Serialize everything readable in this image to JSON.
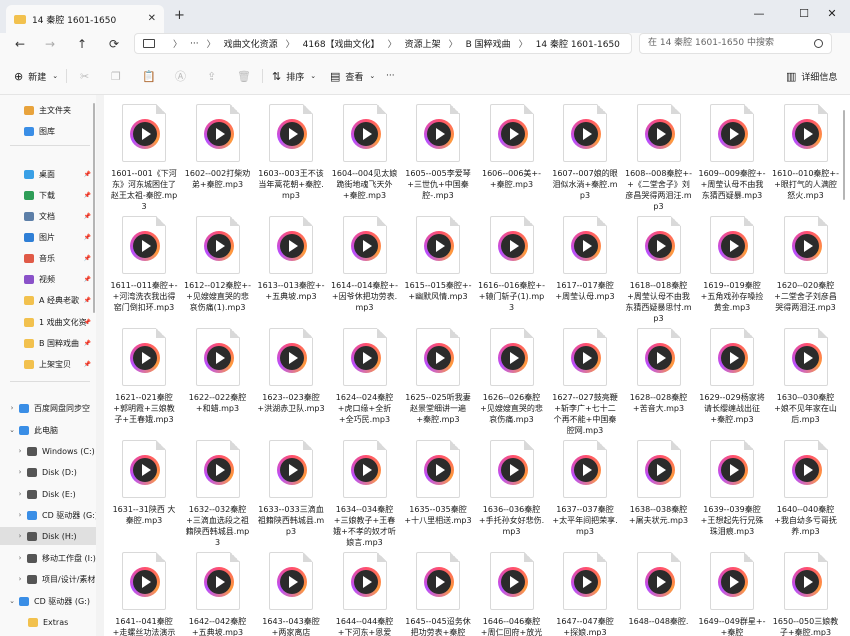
{
  "window": {
    "tab_title": "14 秦腔 1601-1650",
    "new_tab": "+",
    "close_tab": "✕",
    "minimize": "—",
    "maximize": "☐",
    "close": "✕"
  },
  "nav": {
    "back": "←",
    "forward": "→",
    "up": "↑",
    "refresh": "⟳",
    "more": "···",
    "breadcrumbs": [
      "戏曲文化资源",
      "4168【戏曲文化】",
      "资源上架",
      "B 国粹戏曲",
      "14 秦腔 1601-1650"
    ],
    "chevron": "〉",
    "search_placeholder": "在 14 秦腔 1601-1650 中搜索"
  },
  "toolbar": {
    "new_label": "新建",
    "sort_label": "排序",
    "view_label": "查看",
    "more": "···",
    "details_label": "详细信息"
  },
  "sidebar": {
    "items": [
      {
        "label": "主文件夹",
        "icon": "home-icon",
        "color": "#e8a33c"
      },
      {
        "label": "图库",
        "icon": "gallery-icon",
        "color": "#3a8ee6"
      },
      {
        "label": "桌面",
        "icon": "desktop-icon",
        "color": "#3aa0e6"
      },
      {
        "label": "下载",
        "icon": "download-icon",
        "color": "#2e9d57"
      },
      {
        "label": "文档",
        "icon": "document-icon",
        "color": "#5d7fa8"
      },
      {
        "label": "图片",
        "icon": "pictures-icon",
        "color": "#2f7fd6"
      },
      {
        "label": "音乐",
        "icon": "music-icon",
        "color": "#e05a47"
      },
      {
        "label": "视频",
        "icon": "video-icon",
        "color": "#8a52c9"
      },
      {
        "label": "A 经典老歌",
        "icon": "folder-icon",
        "color": "#f2c14e"
      },
      {
        "label": "1 戏曲文化资",
        "icon": "folder-icon",
        "color": "#f2c14e"
      },
      {
        "label": "B 国粹戏曲",
        "icon": "folder-icon",
        "color": "#f2c14e"
      },
      {
        "label": "上架宝贝",
        "icon": "folder-icon",
        "color": "#f2c14e"
      },
      {
        "label": "百度网盘同步空",
        "icon": "cloud-icon",
        "color": "#3a8ee6"
      },
      {
        "label": "此电脑",
        "icon": "computer-icon",
        "color": "#3a8ee6"
      },
      {
        "label": "Windows (C:)",
        "icon": "drive-icon",
        "color": "#555555"
      },
      {
        "label": "Disk (D:)",
        "icon": "drive-icon",
        "color": "#555555"
      },
      {
        "label": "Disk (E:)",
        "icon": "drive-icon",
        "color": "#555555"
      },
      {
        "label": "CD 驱动器 (G:)",
        "icon": "cd-icon",
        "color": "#3a8ee6"
      },
      {
        "label": "Disk (H:)",
        "icon": "drive-icon",
        "color": "#555555"
      },
      {
        "label": "移动工作盘 (I:)",
        "icon": "drive-icon",
        "color": "#555555"
      },
      {
        "label": "项目/设计/素材",
        "icon": "drive-icon",
        "color": "#555555"
      },
      {
        "label": "CD 驱动器 (G:)",
        "icon": "cd-icon",
        "color": "#3a8ee6"
      },
      {
        "label": "Extras",
        "icon": "folder-icon",
        "color": "#f2c14e"
      }
    ]
  },
  "files": [
    "1601--001《下河东》河东城困住了赵王太祖-秦腔.mp3",
    "1602--002打柴劝弟+秦腔.mp3",
    "1603--003王不该当年蒿花朝+秦腔.mp3",
    "1604--004见太娘跪街地魂飞天外+秦腔.mp3",
    "1605--005李爱琴+三世仇+中国秦腔-.mp3",
    "1606--006美+-+秦腔.mp3",
    "1607--007娘的眼泪似水淌+秦腔.mp3",
    "1608--008秦腔+-+《二堂舍子》刘彦昌哭得两泪汪.mp3",
    "1609--009秦腔+-+周莹认母不由我东猜西疑暴.mp3",
    "1610--010秦腔+-+眼打气的人满腔怒火.mp3",
    "1611--011秦腔+-+河湾洗衣我出得窑门倒扣环.mp3",
    "1612--012秦腔+-+见嫂嫂直哭的悲哀伤痛(1).mp3",
    "1613--013秦腔+-+五典坡.mp3",
    "1614--014秦腔+-+因爷休把功劳表.mp3",
    "1615--015秦腔+-+幽默风情.mp3",
    "1616--016秦腔+-+辕门斩子(1).mp3",
    "1617--017秦腔+周莹认母.mp3",
    "1618--018秦腔+周莹认母不由我东猜西疑暴思忖.mp3",
    "1619--019秦腔+五角戏孙存嗓捡黄金.mp3",
    "1620--020秦腔+二堂舍子刘彦昌哭得两泪汪.mp3",
    "1621--021秦腔+郭明霞+三娘教子+王春娥.mp3",
    "1622--022秦腔+和蜡.mp3",
    "1623--023秦腔+洪湖赤卫队.mp3",
    "1624--024秦腔+虎口缘+全折+全巧民.mp3",
    "1625--025听我妻赵景堂细讲一遍+秦腔.mp3",
    "1626--026秦腔+见嫂嫂直哭的悲哀伤痛.mp3",
    "1627--027鼓亮鞭+斩李广+七十二个再不能+中国秦腔网.mp3",
    "1628--028秦腔+苦音大.mp3",
    "1629--029杨家将请长缨缠战出征+秦腔.mp3",
    "1630--030秦腔+娘不见年家在山后.mp3",
    "1631--31陕西 大秦腔.mp3",
    "1632--032秦腔+三滴血选段之祖籍陕西韩城县.mp3",
    "1633--033三滴血祖籍陕西韩城县.mp3",
    "1634--034秦腔+三娘教子+王春娥+不孝的奴才听娘言.mp3",
    "1635--035秦腔+十八里相送.mp3",
    "1636--036秦腔+手托孙女好悲伤.mp3",
    "1637--037秦腔+太平年间把荣享.mp3",
    "1638--038秦腔+屠夫状元.mp3",
    "1639--039秦腔+王想起先行兄殊珠泪痕.mp3",
    "1640--040秦腔+我自幼多亏哥抚养.mp3",
    "1641--041秦腔+走螺丝功法演示",
    "1642--042秦腔+五典坡.mp3",
    "1643--043秦腔+两家离店",
    "1644--044秦腔+下河东+恩爱",
    "1645--045迢务休把功劳表+秦腔",
    "1646--046秦腔+周仁回府+放光",
    "1647--047秦腔+探娘.mp3",
    "1648--048秦腔.",
    "1649--049群星+-+秦腔",
    "1650--050三娘教子+秦腔.mp3"
  ]
}
